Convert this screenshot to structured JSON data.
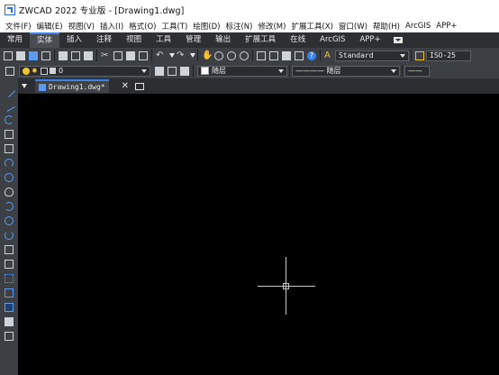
{
  "app": {
    "title": "ZWCAD 2022 专业版 - [Drawing1.dwg]"
  },
  "menu": [
    "文件(F)",
    "编辑(E)",
    "视图(V)",
    "插入(I)",
    "格式(O)",
    "工具(T)",
    "绘图(D)",
    "标注(N)",
    "修改(M)",
    "扩展工具(X)",
    "窗口(W)",
    "帮助(H)",
    "ArcGIS",
    "APP+"
  ],
  "ribbon_tabs": {
    "items": [
      "常用",
      "实体",
      "插入",
      "注释",
      "视图",
      "工具",
      "管理",
      "输出",
      "扩展工具",
      "在线",
      "ArcGIS",
      "APP+"
    ],
    "active": "实体"
  },
  "toolbar": {
    "text_style": "Standard",
    "dim_style": "ISO-25",
    "layer_value": "0",
    "color_value": "随层",
    "linetype_value": "———— 随层",
    "lineweight_value": "——"
  },
  "document": {
    "tab_label": "Drawing1.dwg*"
  },
  "colors": {
    "accent": "#3b84f0",
    "canvas": "#000000",
    "toolbar": "#3c3f44"
  },
  "icons": [
    "save-icon",
    "open-icon",
    "print-icon",
    "cut-icon",
    "copy-icon",
    "paste-icon",
    "undo-icon",
    "redo-icon",
    "pan-icon",
    "zoom-icon",
    "properties-icon",
    "help-icon",
    "text-style-icon",
    "dim-style-icon",
    "layer-icon",
    "lightbulb-icon",
    "sun-icon",
    "lock-icon",
    "line-tool-icon",
    "polyline-tool-icon",
    "arc-tool-icon",
    "polygon-tool-icon",
    "rectangle-tool-icon",
    "circle-tool-icon",
    "cloud-tool-icon",
    "spline-tool-icon",
    "ellipse-tool-icon",
    "block-icon",
    "hatch-icon",
    "table-icon"
  ]
}
